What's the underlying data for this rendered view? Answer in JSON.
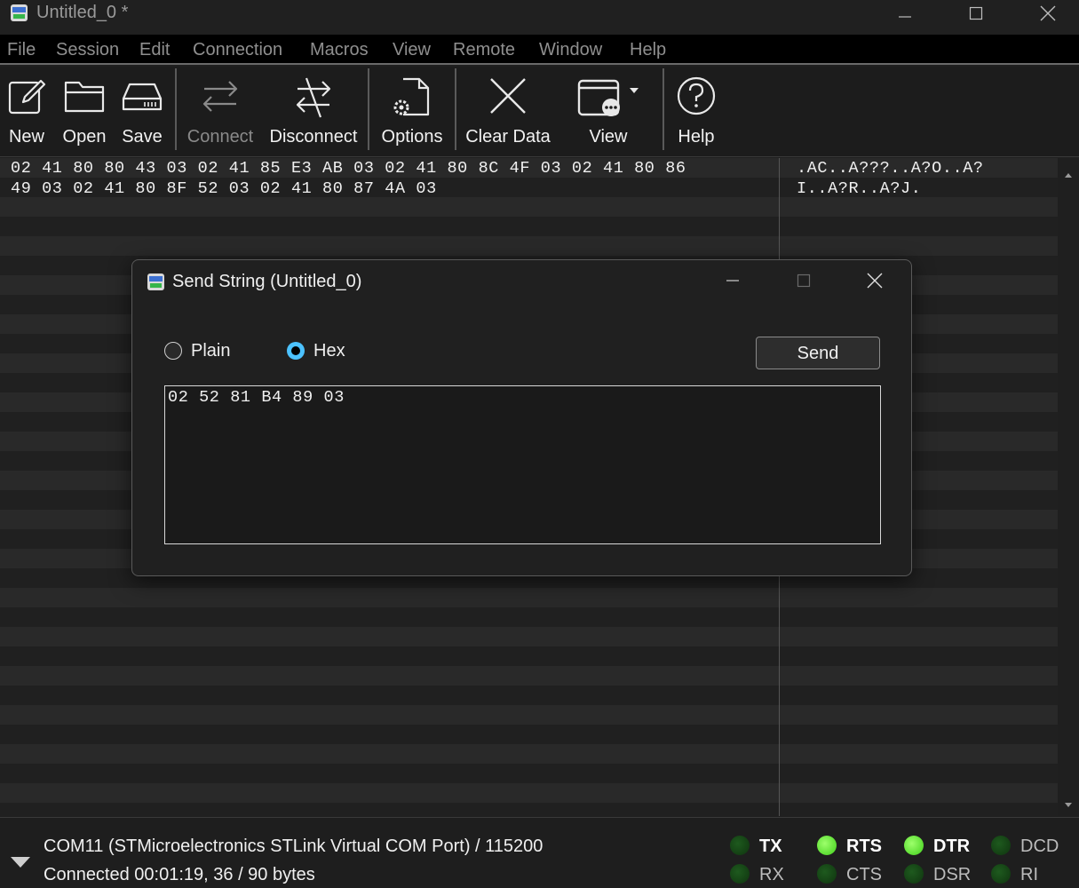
{
  "window": {
    "title": "Untitled_0 *"
  },
  "menu": {
    "items": [
      "File",
      "Session",
      "Edit",
      "Connection",
      "Macros",
      "View",
      "Remote",
      "Window",
      "Help"
    ]
  },
  "toolbar": {
    "new": "New",
    "open": "Open",
    "save": "Save",
    "connect": "Connect",
    "disconnect": "Disconnect",
    "options": "Options",
    "clear_data": "Clear Data",
    "view": "View",
    "help": "Help"
  },
  "hex_view": {
    "hex_lines": [
      "02 41 80 80 43 03 02 41 85 E3 AB 03 02 41 80 8C 4F 03 02 41 80 86",
      "49 03 02 41 80 8F 52 03 02 41 80 87 4A 03"
    ],
    "ascii_lines": [
      ".AC..A???..A?O..A?",
      "I..A?R..A?J."
    ]
  },
  "dialog": {
    "title": "Send String (Untitled_0)",
    "plain_label": "Plain",
    "hex_label": "Hex",
    "selected_mode": "Hex",
    "send_label": "Send",
    "input_value": "02 52 81 B4 89 03"
  },
  "status": {
    "port": "COM11 (STMicroelectronics STLink Virtual COM Port) / 115200",
    "connection": "Connected 00:01:19, 36 / 90 bytes"
  },
  "signals": {
    "tx": "TX",
    "rx": "RX",
    "rts": "RTS",
    "cts": "CTS",
    "dtr": "DTR",
    "dsr": "DSR",
    "dcd": "DCD",
    "ri": "RI",
    "active": [
      "RTS",
      "DTR"
    ]
  },
  "colors": {
    "led_on": "#5fe62c",
    "led_off": "#174a17",
    "radio_accent": "#4cc2ff"
  }
}
